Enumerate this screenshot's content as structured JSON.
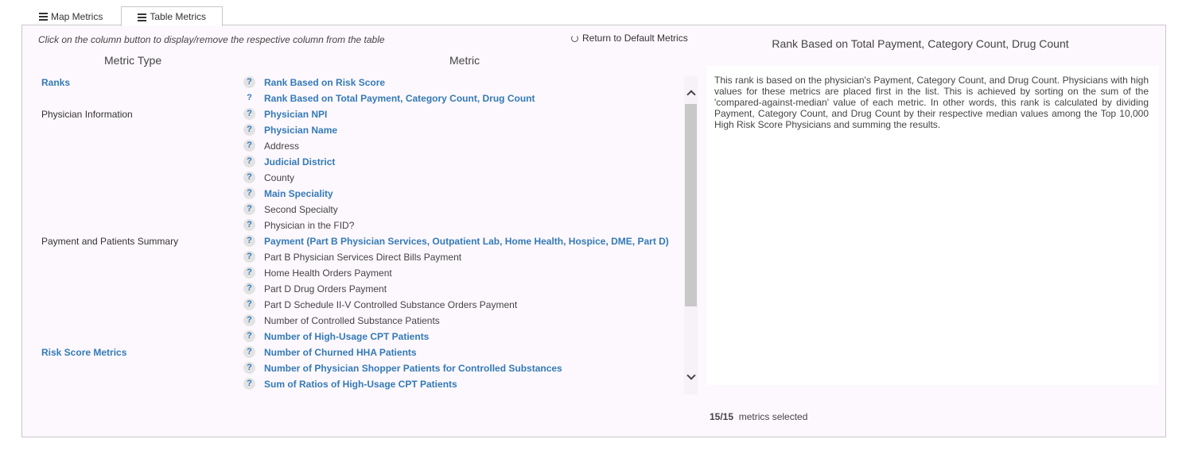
{
  "tabs": [
    {
      "label": "Map Metrics",
      "active": false
    },
    {
      "label": "Table Metrics",
      "active": true
    }
  ],
  "panel": {
    "hint": "Click on the column button to display/remove the respective column from the table",
    "reset_label": "Return to Default Metrics",
    "columns": {
      "metric_type": "Metric Type",
      "metric": "Metric"
    }
  },
  "rows": [
    {
      "category": "Ranks",
      "category_selected": true,
      "metric": "Rank Based on Risk Score",
      "selected": true
    },
    {
      "category": "",
      "category_selected": false,
      "metric": "Rank Based on Total Payment, Category Count, Drug Count",
      "selected": true,
      "plain_help": true
    },
    {
      "category": "Physician Information",
      "category_selected": false,
      "metric": "Physician NPI",
      "selected": true
    },
    {
      "category": "",
      "category_selected": false,
      "metric": "Physician Name",
      "selected": true
    },
    {
      "category": "",
      "category_selected": false,
      "metric": "Address",
      "selected": false
    },
    {
      "category": "",
      "category_selected": false,
      "metric": "Judicial District",
      "selected": true
    },
    {
      "category": "",
      "category_selected": false,
      "metric": "County",
      "selected": false
    },
    {
      "category": "",
      "category_selected": false,
      "metric": "Main Speciality",
      "selected": true
    },
    {
      "category": "",
      "category_selected": false,
      "metric": "Second Specialty",
      "selected": false
    },
    {
      "category": "",
      "category_selected": false,
      "metric": "Physician in the FID?",
      "selected": false
    },
    {
      "category": "Payment and Patients Summary",
      "category_selected": false,
      "metric": "Payment (Part B Physician Services, Outpatient Lab, Home Health, Hospice, DME, Part D)",
      "selected": true
    },
    {
      "category": "",
      "category_selected": false,
      "metric": "Part B Physician Services Direct Bills Payment",
      "selected": false
    },
    {
      "category": "",
      "category_selected": false,
      "metric": "Home Health Orders Payment",
      "selected": false
    },
    {
      "category": "",
      "category_selected": false,
      "metric": "Part D Drug Orders Payment",
      "selected": false
    },
    {
      "category": "",
      "category_selected": false,
      "metric": "Part D Schedule II-V Controlled Substance Orders Payment",
      "selected": false
    },
    {
      "category": "",
      "category_selected": false,
      "metric": "Number of Controlled Substance Patients",
      "selected": false
    },
    {
      "category": "",
      "category_selected": false,
      "metric": "Number of High-Usage CPT Patients",
      "selected": true
    },
    {
      "category": "Risk Score Metrics",
      "category_selected": true,
      "metric": "Number of Churned HHA Patients",
      "selected": true
    },
    {
      "category": "",
      "category_selected": false,
      "metric": "Number of Physician Shopper Patients for Controlled Substances",
      "selected": true
    },
    {
      "category": "",
      "category_selected": false,
      "metric": "Sum of Ratios of High-Usage CPT Patients",
      "selected": true
    }
  ],
  "description": {
    "title": "Rank Based on Total Payment, Category Count, Drug Count",
    "text": "This rank is based on the physician's Payment, Category Count, and Drug Count. Physicians with high values for these metrics are placed first in the list. This is achieved by sorting on the sum of the 'compared-against-median' value of each metric. In other words, this rank is calculated by dividing Payment, Category Count, and Drug Count by their respective median values among the Top 10,000 High Risk Score Physicians and summing the results."
  },
  "selection": {
    "count": "15/15",
    "suffix": "metrics selected"
  },
  "icons": {
    "help": "?"
  },
  "colors": {
    "accent": "#337ab7",
    "panel_bg": "#fdf8fd",
    "scroll_thumb": "#c8c8c8"
  }
}
